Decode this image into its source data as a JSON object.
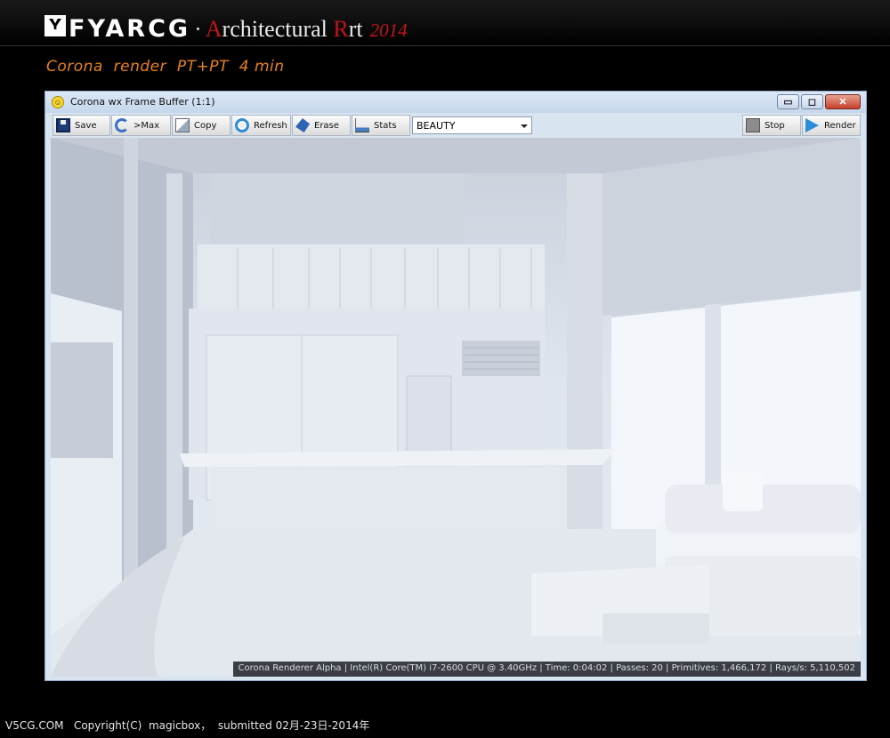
{
  "banner": {
    "brand": "FYARCG",
    "separator": "·",
    "title_first_letter": "A",
    "title_rest_1": "rchitectural ",
    "title_red_letter": "R",
    "title_rest_2": "rt",
    "year": "2014",
    "subtitle": "Corona  render  PT+PT  4 min"
  },
  "window": {
    "title": "Corona wx Frame Buffer (1:1)",
    "controls": {
      "minimize": "▭",
      "maximize": "◻",
      "close": "✕"
    },
    "toolbar": {
      "save": "Save",
      "max": ">Max",
      "copy": "Copy",
      "refresh": "Refresh",
      "erase": "Erase",
      "stats": "Stats",
      "channel": "BEAUTY",
      "stop": "Stop",
      "render": "Render"
    },
    "status": "Corona Renderer Alpha | Intel(R) Core(TM) i7-2600 CPU @ 3.40GHz | Time: 0:04:02 | Passes: 20 | Primitives: 1,466,172 | Rays/s: 5,110,502"
  },
  "footer": "V5CG.COM   Copyright(C)  magicbox，  submitted 02月-23日-2014年",
  "colors": {
    "accent_orange": "#e8801c",
    "brand_red": "#c0141b",
    "window_frame": "#d9e4f1"
  }
}
